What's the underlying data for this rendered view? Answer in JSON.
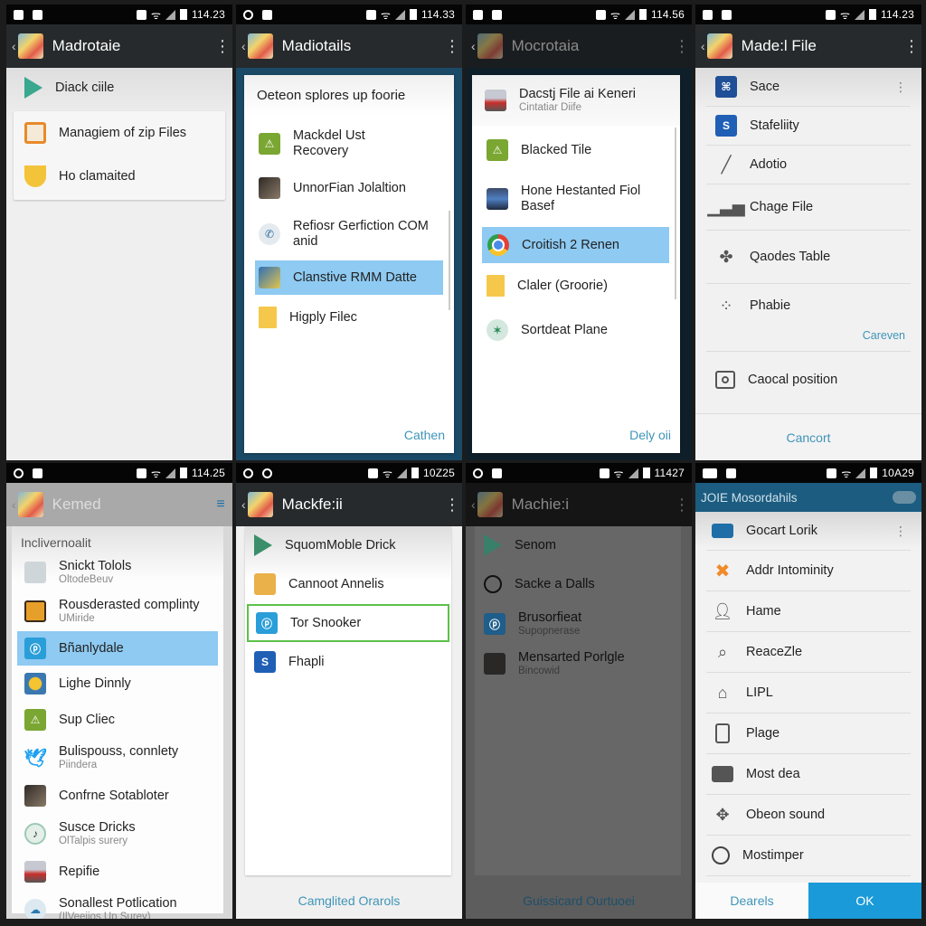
{
  "panels": [
    {
      "status": {
        "time": "114.23"
      },
      "appbar": {
        "title": "Madrotaie"
      },
      "top_item": {
        "label": "Diack ciile",
        "icon": "play-store-icon"
      },
      "card_items": [
        {
          "label": "Managiem of zip Files",
          "icon": "zip-file-icon"
        },
        {
          "label": "Ho clamaited",
          "icon": "shield-icon"
        }
      ]
    },
    {
      "status": {
        "time": "114.33"
      },
      "appbar": {
        "title": "Madiotails"
      },
      "dialog": {
        "title": "Oeteon splores up foorie",
        "items": [
          {
            "label": "Mackdel Ust Recovery",
            "icon": "android-icon"
          },
          {
            "label": "UnnorFian Jolaltion",
            "icon": "photo-icon"
          },
          {
            "label": "Refiosr Gerfiction COM anid",
            "icon": "phone-icon"
          },
          {
            "label": "Clanstive RMM Datte",
            "icon": "image-icon",
            "selected": true
          },
          {
            "label": "Higply Filec",
            "icon": "file-icon"
          }
        ],
        "action": "Cathen"
      }
    },
    {
      "status": {
        "time": "114.56"
      },
      "appbar": {
        "title": "Mocrotaia"
      },
      "dialog": {
        "items": [
          {
            "label": "Dacstj File ai Keneri",
            "sub": "Cintatiar Diife",
            "icon": "photo-icon"
          },
          {
            "label": "Blacked Tile",
            "icon": "android-icon"
          },
          {
            "label": "Hone Hestanted Fiol Basef",
            "icon": "tv-photo-icon"
          },
          {
            "label": "Croitish 2 Renen",
            "icon": "chrome-icon",
            "selected": true
          },
          {
            "label": "Claler (Groorie)",
            "icon": "file-icon"
          },
          {
            "label": "Sortdeat Plane",
            "icon": "star-icon"
          }
        ],
        "action": "Dely oii"
      }
    },
    {
      "status": {
        "time": "114.23"
      },
      "appbar": {
        "title": "Made:l File"
      },
      "items": [
        {
          "label": "Sace",
          "icon": "network-icon",
          "has_menu": true
        },
        {
          "label": "Stafeliity",
          "icon": "s-app-icon"
        },
        {
          "label": "Adotio",
          "icon": "pencil-icon"
        },
        {
          "label": "Chage File",
          "icon": "signal-bars-icon"
        },
        {
          "label": "Qaodes Table",
          "icon": "puzzle-icon"
        },
        {
          "label": "Phabie",
          "icon": "dots-icon",
          "link": "Careven"
        },
        {
          "label": "Caocal position",
          "icon": "camera-icon"
        }
      ],
      "footer": "Cancort"
    },
    {
      "status": {
        "time": "114.25"
      },
      "appbar": {
        "title": "Kemed"
      },
      "section": "Inclivernoalit",
      "items": [
        {
          "label": "Snickt Tolols",
          "sub": "OltodeBeuv",
          "icon": "tool-icon"
        },
        {
          "label": "Rousderasted complinty",
          "sub": "UMiride",
          "icon": "photo-icon"
        },
        {
          "label": "Bñanlydale",
          "icon": "app-icon",
          "selected": true
        },
        {
          "label": "Lighe Dinnly",
          "icon": "sun-icon"
        },
        {
          "label": "Sup Cliec",
          "icon": "android-icon"
        },
        {
          "label": "Bulispouss, connlety",
          "sub": "Piindera",
          "icon": "twitter-icon"
        },
        {
          "label": "Confrne Sotabloter",
          "icon": "photo-icon"
        },
        {
          "label": "Susce Dricks",
          "sub": "OlTalpis surery",
          "icon": "music-icon"
        },
        {
          "label": "Repifie",
          "icon": "car-photo-icon"
        },
        {
          "label": "Sonallest Potlication",
          "sub": "(IlVeeiios Up Surey)",
          "icon": "cloud-icon"
        }
      ]
    },
    {
      "status": {
        "time": "10Z25"
      },
      "appbar": {
        "title": "Mackfe:ii"
      },
      "items": [
        {
          "label": "SquomMoble Drick",
          "icon": "play-store-icon"
        },
        {
          "label": "Cannoot Annelis",
          "icon": "folder-icon"
        },
        {
          "label": "Tor Snooker",
          "icon": "app-icon",
          "focused": true
        },
        {
          "label": "Fhapli",
          "icon": "s-app-icon"
        }
      ],
      "footer": "Camglited Orarols"
    },
    {
      "status": {
        "time": "11427"
      },
      "appbar": {
        "title": "Machie:i"
      },
      "items": [
        {
          "label": "Senom",
          "icon": "play-store-icon"
        },
        {
          "label": "Sacke a Dalls",
          "icon": "location-icon"
        },
        {
          "label": "Brusorfieat",
          "sub": "Supopnerase",
          "icon": "app-icon"
        },
        {
          "label": "Mensarted Porlgle",
          "sub": "Bincowid",
          "icon": "photo-icon"
        }
      ],
      "footer": "Guissicard Ourtuoei"
    },
    {
      "status": {
        "time": "10A29"
      },
      "appbar": {
        "title": "JOIE Mosordahils"
      },
      "items": [
        {
          "label": "Gocart Lorik",
          "icon": "book-icon",
          "has_menu": true
        },
        {
          "label": "Addr Intominity",
          "icon": "tools-icon"
        },
        {
          "label": "Hame",
          "icon": "person-icon"
        },
        {
          "label": "ReaceZle",
          "icon": "search-icon"
        },
        {
          "label": "LIPL",
          "icon": "home-icon"
        },
        {
          "label": "Plage",
          "icon": "tablet-icon"
        },
        {
          "label": "Most dea",
          "icon": "briefcase-icon"
        },
        {
          "label": "Obeon sound",
          "icon": "move-icon"
        },
        {
          "label": "Mostimper",
          "icon": "circle-icon"
        }
      ],
      "buttons": {
        "cancel": "Dearels",
        "ok": "OK"
      }
    }
  ],
  "colors": {
    "accent": "#3f95b8",
    "selected": "#8ecaf2",
    "focus_border": "#5cc04a",
    "ok_button": "#1a9ad8",
    "header_blue": "#1b5c80"
  }
}
